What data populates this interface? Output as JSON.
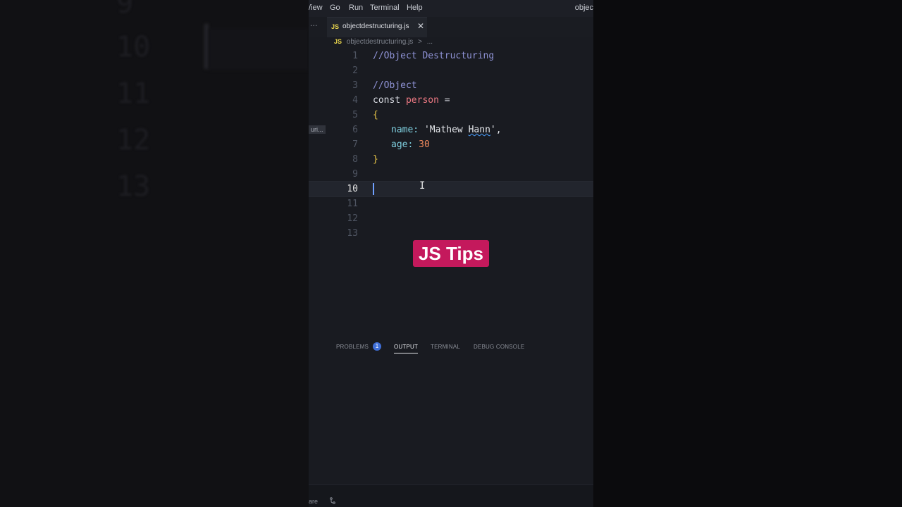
{
  "menu": {
    "items": [
      "View",
      "Go",
      "Run",
      "Terminal",
      "Help"
    ],
    "view_label": "/iew",
    "window_title": "objec"
  },
  "tabs": {
    "more": "···",
    "active": {
      "icon": "JS",
      "name": "objectdestructuring.js",
      "close": "✕"
    }
  },
  "breadcrumb": {
    "icon": "JS",
    "file": "objectdestructuring.js",
    "sep": ">",
    "rest": "..."
  },
  "editor": {
    "active_line": "10",
    "line_numbers": [
      "1",
      "2",
      "3",
      "4",
      "5",
      "6",
      "7",
      "8",
      "9",
      "10",
      "11",
      "12",
      "13"
    ],
    "code": {
      "l1": "//Object Destructuring",
      "l3": "//Object",
      "l4_kw": "const",
      "l4_var": "person",
      "l4_op": "=",
      "l5": "{",
      "l6_key": "name:",
      "l6_str_open": "'Mathew ",
      "l6_str_squig": "Hann",
      "l6_str_close": "',",
      "l7_key": "age:",
      "l7_num": "30",
      "l8": "}"
    },
    "side_label": "uri..."
  },
  "overlay": {
    "tips": "JS Tips"
  },
  "panel": {
    "problems": "PROBLEMS",
    "problems_count": "1",
    "output": "OUTPUT",
    "terminal": "TERMINAL",
    "debug": "DEBUG CONSOLE"
  },
  "status": {
    "left": "are",
    "icon": "branch-icon"
  },
  "ghost": {
    "n10": "10",
    "n11": "11",
    "n12": "12",
    "n13": "13",
    "n9": "9"
  }
}
